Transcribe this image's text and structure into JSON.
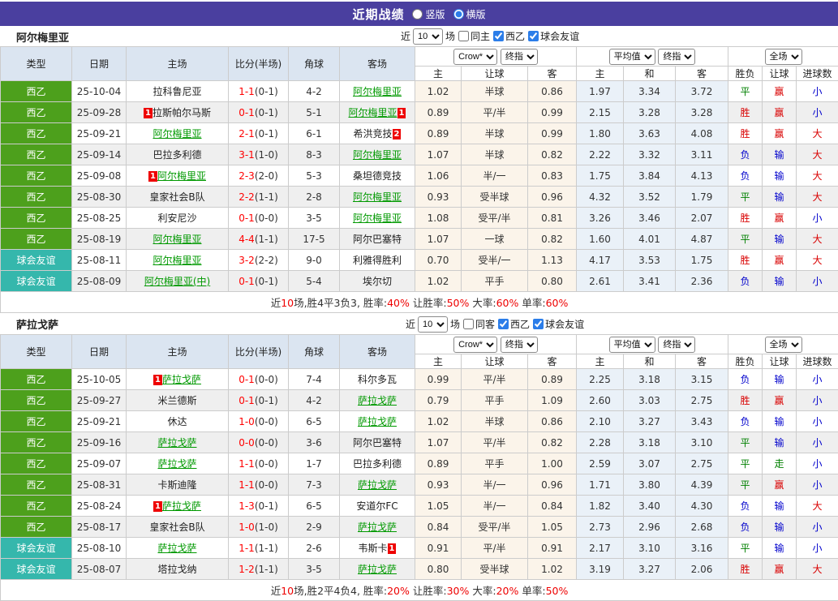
{
  "colors": {
    "topbar_bg": "#4a3f9f",
    "league_green": "#4da01c",
    "league_teal": "#35b7ac",
    "header_cell_bg": "#dbe5f1",
    "handicap_col_bg": "#fbf4ea",
    "europe_col_bg": "#eaf1f8",
    "focal_team_green": "#009900",
    "score_red": "#ff0000",
    "result_red": "#d90000",
    "result_green": "#008000",
    "result_blue": "#0000cc",
    "summary_red": "#ee0000"
  },
  "result_color_map": {
    "胜": "red",
    "平": "green",
    "负": "blue",
    "赢": "red",
    "输": "blue",
    "走": "green",
    "大": "red",
    "小": "blue"
  },
  "header": {
    "title": "近期战绩",
    "radio_vertical": "竖版",
    "radio_horizontal": "横版",
    "selected": "横版"
  },
  "table_head": {
    "type": "类型",
    "date": "日期",
    "home": "主场",
    "score": "比分(半场)",
    "corner": "角球",
    "away": "客场",
    "sub": [
      "主",
      "让球",
      "客",
      "主",
      "和",
      "客",
      "胜负",
      "让球",
      "进球数"
    ],
    "select_labels": [
      "Crow*",
      "终指",
      "平均值",
      "终指",
      "全场"
    ]
  },
  "filter": {
    "near": "近",
    "count": "10",
    "field": "场",
    "league_cb": "西乙",
    "friendly_cb": "球会友谊"
  },
  "sections": [
    {
      "team": "阿尔梅里亚",
      "same_label": "同主",
      "rows": [
        {
          "league": "西乙",
          "league_style": "green",
          "date": "25-10-04",
          "home": "拉科鲁尼亚",
          "home_focal": false,
          "home_card": null,
          "ft": "1-1",
          "ht": "(0-1)",
          "corner": "4-2",
          "away": "阿尔梅里亚",
          "away_focal": true,
          "away_card": null,
          "handicap": [
            "1.02",
            "半球",
            "0.86"
          ],
          "europe": [
            "1.97",
            "3.34",
            "3.72"
          ],
          "results": [
            "平",
            "赢",
            "小"
          ]
        },
        {
          "league": "西乙",
          "league_style": "green",
          "date": "25-09-28",
          "home": "拉斯帕尔马斯",
          "home_focal": false,
          "home_card": "1",
          "ft": "0-1",
          "ht": "(0-1)",
          "corner": "5-1",
          "away": "阿尔梅里亚",
          "away_focal": true,
          "away_card": "1",
          "handicap": [
            "0.89",
            "平/半",
            "0.99"
          ],
          "europe": [
            "2.15",
            "3.28",
            "3.28"
          ],
          "results": [
            "胜",
            "赢",
            "小"
          ]
        },
        {
          "league": "西乙",
          "league_style": "green",
          "date": "25-09-21",
          "home": "阿尔梅里亚",
          "home_focal": true,
          "home_card": null,
          "ft": "2-1",
          "ht": "(0-1)",
          "corner": "6-1",
          "away": "希洪竞技",
          "away_focal": false,
          "away_card": "2",
          "handicap": [
            "0.89",
            "半球",
            "0.99"
          ],
          "europe": [
            "1.80",
            "3.63",
            "4.08"
          ],
          "results": [
            "胜",
            "赢",
            "大"
          ]
        },
        {
          "league": "西乙",
          "league_style": "green",
          "date": "25-09-14",
          "home": "巴拉多利德",
          "home_focal": false,
          "home_card": null,
          "ft": "3-1",
          "ht": "(1-0)",
          "corner": "8-3",
          "away": "阿尔梅里亚",
          "away_focal": true,
          "away_card": null,
          "handicap": [
            "1.07",
            "半球",
            "0.82"
          ],
          "europe": [
            "2.22",
            "3.32",
            "3.11"
          ],
          "results": [
            "负",
            "输",
            "大"
          ]
        },
        {
          "league": "西乙",
          "league_style": "green",
          "date": "25-09-08",
          "home": "阿尔梅里亚",
          "home_focal": true,
          "home_card": "1",
          "ft": "2-3",
          "ht": "(2-0)",
          "corner": "5-3",
          "away": "桑坦德竞技",
          "away_focal": false,
          "away_card": null,
          "handicap": [
            "1.06",
            "半/一",
            "0.83"
          ],
          "europe": [
            "1.75",
            "3.84",
            "4.13"
          ],
          "results": [
            "负",
            "输",
            "大"
          ]
        },
        {
          "league": "西乙",
          "league_style": "green",
          "date": "25-08-30",
          "home": "皇家社会B队",
          "home_focal": false,
          "home_card": null,
          "ft": "2-2",
          "ht": "(1-1)",
          "corner": "2-8",
          "away": "阿尔梅里亚",
          "away_focal": true,
          "away_card": null,
          "handicap": [
            "0.93",
            "受半球",
            "0.96"
          ],
          "europe": [
            "4.32",
            "3.52",
            "1.79"
          ],
          "results": [
            "平",
            "输",
            "大"
          ]
        },
        {
          "league": "西乙",
          "league_style": "green",
          "date": "25-08-25",
          "home": "利安尼沙",
          "home_focal": false,
          "home_card": null,
          "ft": "0-1",
          "ht": "(0-0)",
          "corner": "3-5",
          "away": "阿尔梅里亚",
          "away_focal": true,
          "away_card": null,
          "handicap": [
            "1.08",
            "受平/半",
            "0.81"
          ],
          "europe": [
            "3.26",
            "3.46",
            "2.07"
          ],
          "results": [
            "胜",
            "赢",
            "小"
          ]
        },
        {
          "league": "西乙",
          "league_style": "green",
          "date": "25-08-19",
          "home": "阿尔梅里亚",
          "home_focal": true,
          "home_card": null,
          "ft": "4-4",
          "ht": "(1-1)",
          "corner": "17-5",
          "away": "阿尔巴塞特",
          "away_focal": false,
          "away_card": null,
          "handicap": [
            "1.07",
            "一球",
            "0.82"
          ],
          "europe": [
            "1.60",
            "4.01",
            "4.87"
          ],
          "results": [
            "平",
            "输",
            "大"
          ]
        },
        {
          "league": "球会友谊",
          "league_style": "teal",
          "date": "25-08-11",
          "home": "阿尔梅里亚",
          "home_focal": true,
          "home_card": null,
          "ft": "3-2",
          "ht": "(2-2)",
          "corner": "9-0",
          "away": "利雅得胜利",
          "away_focal": false,
          "away_card": null,
          "handicap": [
            "0.70",
            "受半/一",
            "1.13"
          ],
          "europe": [
            "4.17",
            "3.53",
            "1.75"
          ],
          "results": [
            "胜",
            "赢",
            "大"
          ]
        },
        {
          "league": "球会友谊",
          "league_style": "teal",
          "date": "25-08-09",
          "home": "阿尔梅里亚(中)",
          "home_focal": true,
          "home_card": null,
          "ft": "0-1",
          "ht": "(0-1)",
          "corner": "5-4",
          "away": "埃尔切",
          "away_focal": false,
          "away_card": null,
          "handicap": [
            "1.02",
            "平手",
            "0.80"
          ],
          "europe": [
            "2.61",
            "3.41",
            "2.36"
          ],
          "results": [
            "负",
            "输",
            "小"
          ]
        }
      ],
      "summary_parts": [
        {
          "t": "近"
        },
        {
          "t": "10",
          "red": true
        },
        {
          "t": "场,胜4平3负3, 胜率:"
        },
        {
          "t": "40%",
          "red": true
        },
        {
          "t": " 让胜率:"
        },
        {
          "t": "50%",
          "red": true
        },
        {
          "t": " 大率:"
        },
        {
          "t": "60%",
          "red": true
        },
        {
          "t": " 单率:"
        },
        {
          "t": "60%",
          "red": true
        }
      ]
    },
    {
      "team": "萨拉戈萨",
      "same_label": "同客",
      "rows": [
        {
          "league": "西乙",
          "league_style": "green",
          "date": "25-10-05",
          "home": "萨拉戈萨",
          "home_focal": true,
          "home_card": "1",
          "ft": "0-1",
          "ht": "(0-0)",
          "corner": "7-4",
          "away": "科尔多瓦",
          "away_focal": false,
          "away_card": null,
          "handicap": [
            "0.99",
            "平/半",
            "0.89"
          ],
          "europe": [
            "2.25",
            "3.18",
            "3.15"
          ],
          "results": [
            "负",
            "输",
            "小"
          ]
        },
        {
          "league": "西乙",
          "league_style": "green",
          "date": "25-09-27",
          "home": "米兰德斯",
          "home_focal": false,
          "home_card": null,
          "ft": "0-1",
          "ht": "(0-1)",
          "corner": "4-2",
          "away": "萨拉戈萨",
          "away_focal": true,
          "away_card": null,
          "handicap": [
            "0.79",
            "平手",
            "1.09"
          ],
          "europe": [
            "2.60",
            "3.03",
            "2.75"
          ],
          "results": [
            "胜",
            "赢",
            "小"
          ]
        },
        {
          "league": "西乙",
          "league_style": "green",
          "date": "25-09-21",
          "home": "休达",
          "home_focal": false,
          "home_card": null,
          "ft": "1-0",
          "ht": "(0-0)",
          "corner": "6-5",
          "away": "萨拉戈萨",
          "away_focal": true,
          "away_card": null,
          "handicap": [
            "1.02",
            "半球",
            "0.86"
          ],
          "europe": [
            "2.10",
            "3.27",
            "3.43"
          ],
          "results": [
            "负",
            "输",
            "小"
          ]
        },
        {
          "league": "西乙",
          "league_style": "green",
          "date": "25-09-16",
          "home": "萨拉戈萨",
          "home_focal": true,
          "home_card": null,
          "ft": "0-0",
          "ht": "(0-0)",
          "corner": "3-6",
          "away": "阿尔巴塞特",
          "away_focal": false,
          "away_card": null,
          "handicap": [
            "1.07",
            "平/半",
            "0.82"
          ],
          "europe": [
            "2.28",
            "3.18",
            "3.10"
          ],
          "results": [
            "平",
            "输",
            "小"
          ]
        },
        {
          "league": "西乙",
          "league_style": "green",
          "date": "25-09-07",
          "home": "萨拉戈萨",
          "home_focal": true,
          "home_card": null,
          "ft": "1-1",
          "ht": "(0-0)",
          "corner": "1-7",
          "away": "巴拉多利德",
          "away_focal": false,
          "away_card": null,
          "handicap": [
            "0.89",
            "平手",
            "1.00"
          ],
          "europe": [
            "2.59",
            "3.07",
            "2.75"
          ],
          "results": [
            "平",
            "走",
            "小"
          ]
        },
        {
          "league": "西乙",
          "league_style": "green",
          "date": "25-08-31",
          "home": "卡斯迪隆",
          "home_focal": false,
          "home_card": null,
          "ft": "1-1",
          "ht": "(0-0)",
          "corner": "7-3",
          "away": "萨拉戈萨",
          "away_focal": true,
          "away_card": null,
          "handicap": [
            "0.93",
            "半/一",
            "0.96"
          ],
          "europe": [
            "1.71",
            "3.80",
            "4.39"
          ],
          "results": [
            "平",
            "赢",
            "小"
          ]
        },
        {
          "league": "西乙",
          "league_style": "green",
          "date": "25-08-24",
          "home": "萨拉戈萨",
          "home_focal": true,
          "home_card": "1",
          "ft": "1-3",
          "ht": "(0-1)",
          "corner": "6-5",
          "away": "安道尔FC",
          "away_focal": false,
          "away_card": null,
          "handicap": [
            "1.05",
            "半/一",
            "0.84"
          ],
          "europe": [
            "1.82",
            "3.40",
            "4.30"
          ],
          "results": [
            "负",
            "输",
            "大"
          ]
        },
        {
          "league": "西乙",
          "league_style": "green",
          "date": "25-08-17",
          "home": "皇家社会B队",
          "home_focal": false,
          "home_card": null,
          "ft": "1-0",
          "ht": "(1-0)",
          "corner": "2-9",
          "away": "萨拉戈萨",
          "away_focal": true,
          "away_card": null,
          "handicap": [
            "0.84",
            "受平/半",
            "1.05"
          ],
          "europe": [
            "2.73",
            "2.96",
            "2.68"
          ],
          "results": [
            "负",
            "输",
            "小"
          ]
        },
        {
          "league": "球会友谊",
          "league_style": "teal",
          "date": "25-08-10",
          "home": "萨拉戈萨",
          "home_focal": true,
          "home_card": null,
          "ft": "1-1",
          "ht": "(1-1)",
          "corner": "2-6",
          "away": "韦斯卡",
          "away_focal": false,
          "away_card": "1",
          "handicap": [
            "0.91",
            "平/半",
            "0.91"
          ],
          "europe": [
            "2.17",
            "3.10",
            "3.16"
          ],
          "results": [
            "平",
            "输",
            "小"
          ]
        },
        {
          "league": "球会友谊",
          "league_style": "teal",
          "date": "25-08-07",
          "home": "塔拉戈纳",
          "home_focal": false,
          "home_card": null,
          "ft": "1-2",
          "ht": "(1-1)",
          "corner": "3-5",
          "away": "萨拉戈萨",
          "away_focal": true,
          "away_card": null,
          "handicap": [
            "0.80",
            "受半球",
            "1.02"
          ],
          "europe": [
            "3.19",
            "3.27",
            "2.06"
          ],
          "results": [
            "胜",
            "赢",
            "大"
          ]
        }
      ],
      "summary_parts": [
        {
          "t": "近"
        },
        {
          "t": "10",
          "red": true
        },
        {
          "t": "场,胜2平4负4, 胜率:"
        },
        {
          "t": "20%",
          "red": true
        },
        {
          "t": " 让胜率:"
        },
        {
          "t": "30%",
          "red": true
        },
        {
          "t": " 大率:"
        },
        {
          "t": "20%",
          "red": true
        },
        {
          "t": " 单率:"
        },
        {
          "t": "50%",
          "red": true
        }
      ]
    }
  ]
}
